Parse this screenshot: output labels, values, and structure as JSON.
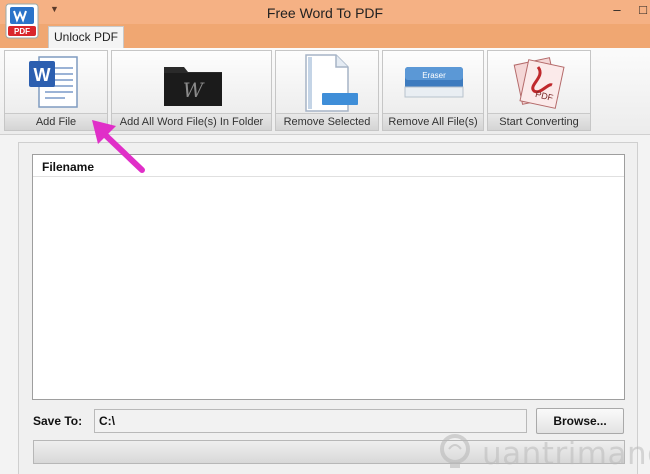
{
  "window": {
    "title": "Free Word To PDF",
    "minimize_label": "–",
    "maximize_label": "□",
    "logo_text": "PDF"
  },
  "tabs": [
    {
      "label": "Unlock PDF",
      "active": true
    }
  ],
  "toolbar": {
    "buttons": [
      {
        "id": "add-file",
        "label": "Add File",
        "icon": "word-document-icon"
      },
      {
        "id": "add-folder",
        "label": "Add All Word File(s) In Folder",
        "icon": "word-folder-icon"
      },
      {
        "id": "remove-selected",
        "label": "Remove Selected",
        "icon": "remove-document-icon"
      },
      {
        "id": "remove-all",
        "label": "Remove All File(s)",
        "icon": "eraser-icon"
      },
      {
        "id": "start-converting",
        "label": "Start Converting",
        "icon": "pdf-convert-icon"
      }
    ],
    "eraser_text": "Eraser",
    "pdf_text": "PDF"
  },
  "file_list": {
    "columns": [
      "Filename"
    ],
    "rows": []
  },
  "save_to": {
    "label": "Save To:",
    "value": "C:\\",
    "browse_label": "Browse..."
  },
  "progress": {
    "value": 0
  },
  "watermark": {
    "text": "uantrimang"
  },
  "colors": {
    "titlebar": "#f5b184",
    "tabstrip": "#f0a772",
    "annotation_arrow": "#e02fc8"
  }
}
